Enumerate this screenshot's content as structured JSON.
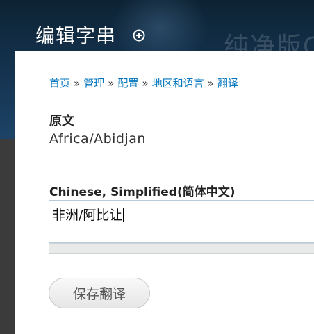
{
  "header": {
    "title": "编辑字串",
    "watermark": "纯净版C",
    "add_icon": "plus-circle-icon"
  },
  "breadcrumb": {
    "items": [
      "首页",
      "管理",
      "配置",
      "地区和语言",
      "翻译"
    ],
    "separator": "»"
  },
  "form": {
    "source_label": "原文",
    "source_value": "Africa/Abidjan",
    "translation_label": "Chinese, Simplified(简体中文)",
    "translation_value": "非洲/阿比让",
    "save_label": "保存翻译"
  },
  "colors": {
    "link": "#0074bd",
    "header_bg": "#153451",
    "content_bg": "#ffffff"
  }
}
